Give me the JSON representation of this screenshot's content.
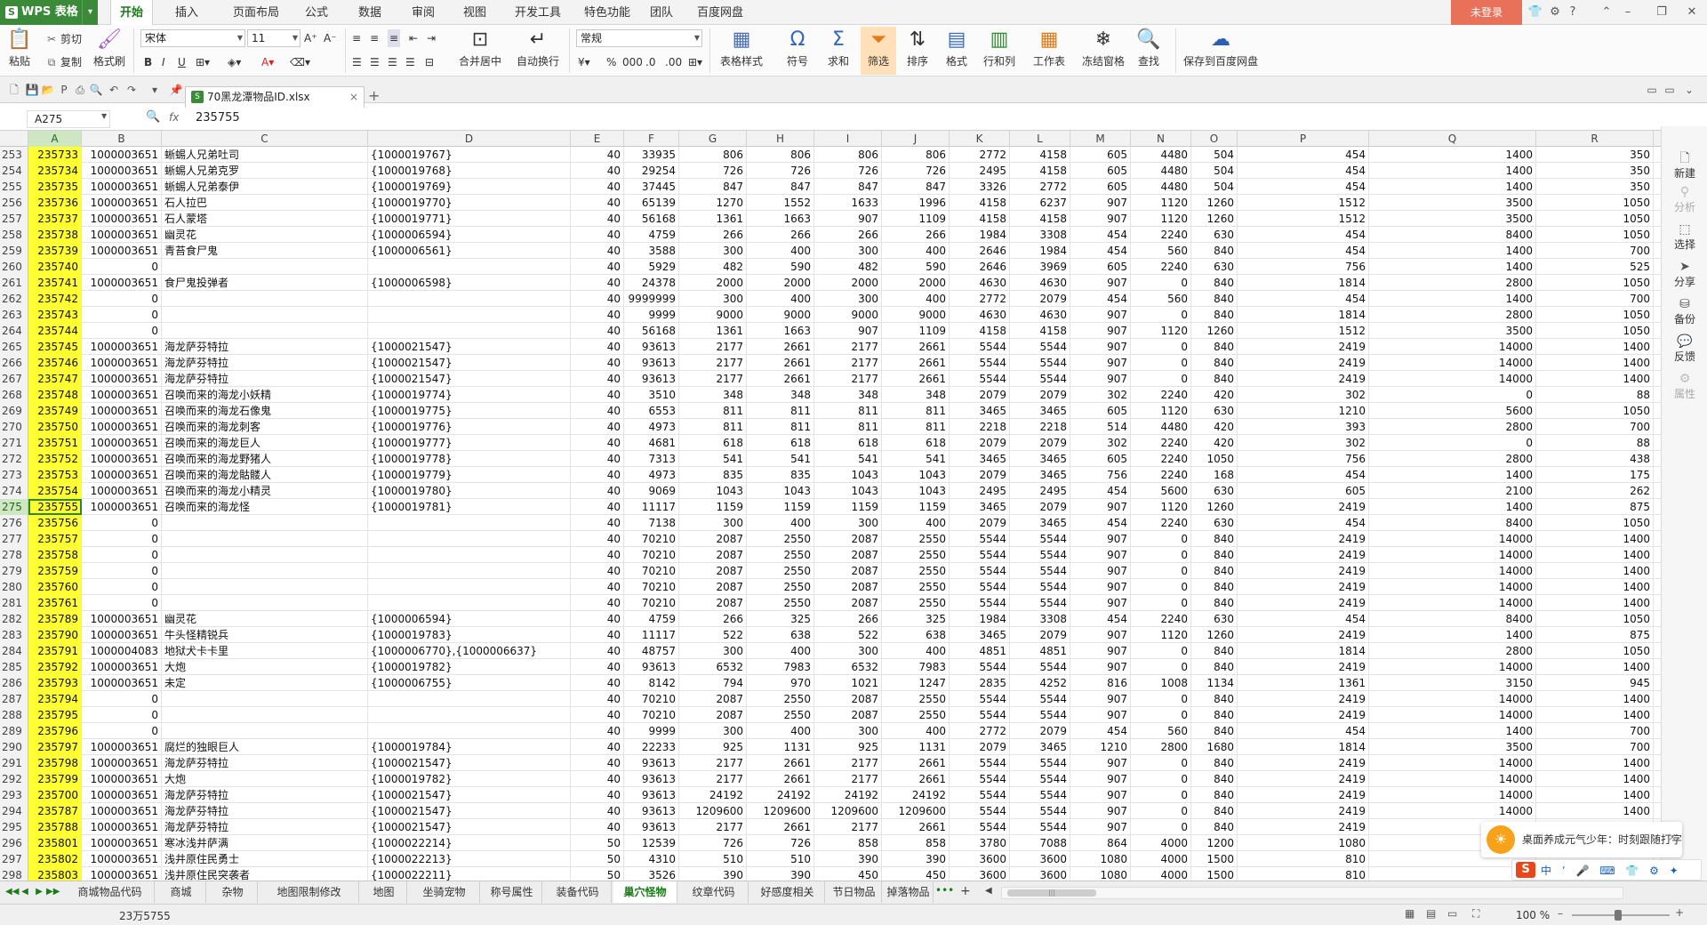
{
  "app": {
    "name": "WPS 表格",
    "dropdown": "▾",
    "login": "未登录"
  },
  "menu": [
    "开始",
    "插入",
    "页面布局",
    "公式",
    "数据",
    "审阅",
    "视图",
    "开发工具",
    "特色功能",
    "团队",
    "百度网盘"
  ],
  "ribbon": {
    "paste": "粘贴",
    "cut": "剪切",
    "copy": "复制",
    "format_painter": "格式刷",
    "font": "宋体",
    "size": "11",
    "bold": "B",
    "italic": "I",
    "underline": "U",
    "merge": "合并居中",
    "wrap": "自动换行",
    "numfmt": "常规",
    "percent": "%",
    "table_style": "表格样式",
    "symbol": "符号",
    "sum": "求和",
    "filter": "筛选",
    "sort": "排序",
    "format": "格式",
    "rowcol": "行和列",
    "sheet": "工作表",
    "freeze": "冻结窗格",
    "find": "查找",
    "save_baidu": "保存到百度网盘"
  },
  "doc": {
    "tab": "70黑龙潭物品ID.xlsx",
    "close": "×",
    "add": "+"
  },
  "formula": {
    "cell": "A275",
    "fx": "fx",
    "value": "235755"
  },
  "columns": [
    "A",
    "B",
    "C",
    "D",
    "E",
    "F",
    "G",
    "H",
    "I",
    "J",
    "K",
    "L",
    "M",
    "N",
    "O",
    "P",
    "Q",
    "R"
  ],
  "rows": [
    {
      "n": "253",
      "a": "235733",
      "b": "1000003651",
      "c": "蜥蜴人兄弟吐司",
      "d": "{1000019767}",
      "e": "40",
      "f": "33935",
      "g": "806",
      "h": "806",
      "i": "806",
      "j": "806",
      "k": "2772",
      "l": "4158",
      "m": "605",
      "nn": "4480",
      "o": "504",
      "p": "454",
      "q": "1400",
      "r": "350"
    },
    {
      "n": "254",
      "a": "235734",
      "b": "1000003651",
      "c": "蜥蜴人兄弟克罗",
      "d": "{1000019768}",
      "e": "40",
      "f": "29254",
      "g": "726",
      "h": "726",
      "i": "726",
      "j": "726",
      "k": "2495",
      "l": "4158",
      "m": "605",
      "nn": "4480",
      "o": "504",
      "p": "454",
      "q": "1400",
      "r": "350"
    },
    {
      "n": "255",
      "a": "235735",
      "b": "1000003651",
      "c": "蜥蜴人兄弟泰伊",
      "d": "{1000019769}",
      "e": "40",
      "f": "37445",
      "g": "847",
      "h": "847",
      "i": "847",
      "j": "847",
      "k": "3326",
      "l": "2772",
      "m": "605",
      "nn": "4480",
      "o": "504",
      "p": "454",
      "q": "1400",
      "r": "350"
    },
    {
      "n": "256",
      "a": "235736",
      "b": "1000003651",
      "c": "石人拉巴",
      "d": "{1000019770}",
      "e": "40",
      "f": "65139",
      "g": "1270",
      "h": "1552",
      "i": "1633",
      "j": "1996",
      "k": "4158",
      "l": "6237",
      "m": "907",
      "nn": "1120",
      "o": "1260",
      "p": "1512",
      "q": "3500",
      "r": "1050"
    },
    {
      "n": "257",
      "a": "235737",
      "b": "1000003651",
      "c": "石人蒙塔",
      "d": "{1000019771}",
      "e": "40",
      "f": "56168",
      "g": "1361",
      "h": "1663",
      "i": "907",
      "j": "1109",
      "k": "4158",
      "l": "4158",
      "m": "907",
      "nn": "1120",
      "o": "1260",
      "p": "1512",
      "q": "3500",
      "r": "1050"
    },
    {
      "n": "258",
      "a": "235738",
      "b": "1000003651",
      "c": "幽灵花",
      "d": "{1000006594}",
      "e": "40",
      "f": "4759",
      "g": "266",
      "h": "266",
      "i": "266",
      "j": "266",
      "k": "1984",
      "l": "3308",
      "m": "454",
      "nn": "2240",
      "o": "630",
      "p": "454",
      "q": "8400",
      "r": "1050"
    },
    {
      "n": "259",
      "a": "235739",
      "b": "1000003651",
      "c": "青苔食尸鬼",
      "d": "{1000006561}",
      "e": "40",
      "f": "3588",
      "g": "300",
      "h": "400",
      "i": "300",
      "j": "400",
      "k": "2646",
      "l": "1984",
      "m": "454",
      "nn": "560",
      "o": "840",
      "p": "454",
      "q": "1400",
      "r": "700"
    },
    {
      "n": "260",
      "a": "235740",
      "b": "0",
      "c": "",
      "d": "",
      "e": "40",
      "f": "5929",
      "g": "482",
      "h": "590",
      "i": "482",
      "j": "590",
      "k": "2646",
      "l": "3969",
      "m": "605",
      "nn": "2240",
      "o": "630",
      "p": "756",
      "q": "1400",
      "r": "525"
    },
    {
      "n": "261",
      "a": "235741",
      "b": "1000003651",
      "c": "食尸鬼投弹者",
      "d": "{1000006598}",
      "e": "40",
      "f": "24378",
      "g": "2000",
      "h": "2000",
      "i": "2000",
      "j": "2000",
      "k": "4630",
      "l": "4630",
      "m": "907",
      "nn": "0",
      "o": "840",
      "p": "1814",
      "q": "2800",
      "r": "1050"
    },
    {
      "n": "262",
      "a": "235742",
      "b": "0",
      "c": "",
      "d": "",
      "e": "40",
      "f": "9999999",
      "g": "300",
      "h": "400",
      "i": "300",
      "j": "400",
      "k": "2772",
      "l": "2079",
      "m": "454",
      "nn": "560",
      "o": "840",
      "p": "454",
      "q": "1400",
      "r": "700"
    },
    {
      "n": "263",
      "a": "235743",
      "b": "0",
      "c": "",
      "d": "",
      "e": "40",
      "f": "9999",
      "g": "9000",
      "h": "9000",
      "i": "9000",
      "j": "9000",
      "k": "4630",
      "l": "4630",
      "m": "907",
      "nn": "0",
      "o": "840",
      "p": "1814",
      "q": "2800",
      "r": "1050"
    },
    {
      "n": "264",
      "a": "235744",
      "b": "0",
      "c": "",
      "d": "",
      "e": "40",
      "f": "56168",
      "g": "1361",
      "h": "1663",
      "i": "907",
      "j": "1109",
      "k": "4158",
      "l": "4158",
      "m": "907",
      "nn": "1120",
      "o": "1260",
      "p": "1512",
      "q": "3500",
      "r": "1050"
    },
    {
      "n": "265",
      "a": "235745",
      "b": "1000003651",
      "c": "海龙萨芬特拉",
      "d": "{1000021547}",
      "e": "40",
      "f": "93613",
      "g": "2177",
      "h": "2661",
      "i": "2177",
      "j": "2661",
      "k": "5544",
      "l": "5544",
      "m": "907",
      "nn": "0",
      "o": "840",
      "p": "2419",
      "q": "14000",
      "r": "1400"
    },
    {
      "n": "266",
      "a": "235746",
      "b": "1000003651",
      "c": "海龙萨芬特拉",
      "d": "{1000021547}",
      "e": "40",
      "f": "93613",
      "g": "2177",
      "h": "2661",
      "i": "2177",
      "j": "2661",
      "k": "5544",
      "l": "5544",
      "m": "907",
      "nn": "0",
      "o": "840",
      "p": "2419",
      "q": "14000",
      "r": "1400"
    },
    {
      "n": "267",
      "a": "235747",
      "b": "1000003651",
      "c": "海龙萨芬特拉",
      "d": "{1000021547}",
      "e": "40",
      "f": "93613",
      "g": "2177",
      "h": "2661",
      "i": "2177",
      "j": "2661",
      "k": "5544",
      "l": "5544",
      "m": "907",
      "nn": "0",
      "o": "840",
      "p": "2419",
      "q": "14000",
      "r": "1400"
    },
    {
      "n": "268",
      "a": "235748",
      "b": "1000003651",
      "c": "召唤而来的海龙小妖精",
      "d": "{1000019774}",
      "e": "40",
      "f": "3510",
      "g": "348",
      "h": "348",
      "i": "348",
      "j": "348",
      "k": "2079",
      "l": "2079",
      "m": "302",
      "nn": "2240",
      "o": "420",
      "p": "302",
      "q": "0",
      "r": "88"
    },
    {
      "n": "269",
      "a": "235749",
      "b": "1000003651",
      "c": "召唤而来的海龙石像鬼",
      "d": "{1000019775}",
      "e": "40",
      "f": "6553",
      "g": "811",
      "h": "811",
      "i": "811",
      "j": "811",
      "k": "3465",
      "l": "3465",
      "m": "605",
      "nn": "1120",
      "o": "630",
      "p": "1210",
      "q": "5600",
      "r": "1050"
    },
    {
      "n": "270",
      "a": "235750",
      "b": "1000003651",
      "c": "召唤而来的海龙刺客",
      "d": "{1000019776}",
      "e": "40",
      "f": "4973",
      "g": "811",
      "h": "811",
      "i": "811",
      "j": "811",
      "k": "2218",
      "l": "2218",
      "m": "514",
      "nn": "4480",
      "o": "420",
      "p": "393",
      "q": "2800",
      "r": "700"
    },
    {
      "n": "271",
      "a": "235751",
      "b": "1000003651",
      "c": "召唤而来的海龙巨人",
      "d": "{1000019777}",
      "e": "40",
      "f": "4681",
      "g": "618",
      "h": "618",
      "i": "618",
      "j": "618",
      "k": "2079",
      "l": "2079",
      "m": "302",
      "nn": "2240",
      "o": "420",
      "p": "302",
      "q": "0",
      "r": "88"
    },
    {
      "n": "272",
      "a": "235752",
      "b": "1000003651",
      "c": "召唤而来的海龙野猪人",
      "d": "{1000019778}",
      "e": "40",
      "f": "7313",
      "g": "541",
      "h": "541",
      "i": "541",
      "j": "541",
      "k": "3465",
      "l": "3465",
      "m": "605",
      "nn": "2240",
      "o": "1050",
      "p": "756",
      "q": "2800",
      "r": "438"
    },
    {
      "n": "273",
      "a": "235753",
      "b": "1000003651",
      "c": "召唤而来的海龙骷髅人",
      "d": "{1000019779}",
      "e": "40",
      "f": "4973",
      "g": "835",
      "h": "835",
      "i": "1043",
      "j": "1043",
      "k": "2079",
      "l": "3465",
      "m": "756",
      "nn": "2240",
      "o": "168",
      "p": "454",
      "q": "1400",
      "r": "175"
    },
    {
      "n": "274",
      "a": "235754",
      "b": "1000003651",
      "c": "召唤而来的海龙小精灵",
      "d": "{1000019780}",
      "e": "40",
      "f": "9069",
      "g": "1043",
      "h": "1043",
      "i": "1043",
      "j": "1043",
      "k": "2495",
      "l": "2495",
      "m": "454",
      "nn": "5600",
      "o": "630",
      "p": "605",
      "q": "2100",
      "r": "262"
    },
    {
      "n": "275",
      "a": "235755",
      "b": "1000003651",
      "c": "召唤而来的海龙怪",
      "d": "{1000019781}",
      "e": "40",
      "f": "11117",
      "g": "1159",
      "h": "1159",
      "i": "1159",
      "j": "1159",
      "k": "3465",
      "l": "2079",
      "m": "907",
      "nn": "1120",
      "o": "1260",
      "p": "2419",
      "q": "1400",
      "r": "875",
      "active": true
    },
    {
      "n": "276",
      "a": "235756",
      "b": "0",
      "c": "",
      "d": "",
      "e": "40",
      "f": "7138",
      "g": "300",
      "h": "400",
      "i": "300",
      "j": "400",
      "k": "2079",
      "l": "3465",
      "m": "454",
      "nn": "2240",
      "o": "630",
      "p": "454",
      "q": "8400",
      "r": "1050"
    },
    {
      "n": "277",
      "a": "235757",
      "b": "0",
      "c": "",
      "d": "",
      "e": "40",
      "f": "70210",
      "g": "2087",
      "h": "2550",
      "i": "2087",
      "j": "2550",
      "k": "5544",
      "l": "5544",
      "m": "907",
      "nn": "0",
      "o": "840",
      "p": "2419",
      "q": "14000",
      "r": "1400"
    },
    {
      "n": "278",
      "a": "235758",
      "b": "0",
      "c": "",
      "d": "",
      "e": "40",
      "f": "70210",
      "g": "2087",
      "h": "2550",
      "i": "2087",
      "j": "2550",
      "k": "5544",
      "l": "5544",
      "m": "907",
      "nn": "0",
      "o": "840",
      "p": "2419",
      "q": "14000",
      "r": "1400"
    },
    {
      "n": "279",
      "a": "235759",
      "b": "0",
      "c": "",
      "d": "",
      "e": "40",
      "f": "70210",
      "g": "2087",
      "h": "2550",
      "i": "2087",
      "j": "2550",
      "k": "5544",
      "l": "5544",
      "m": "907",
      "nn": "0",
      "o": "840",
      "p": "2419",
      "q": "14000",
      "r": "1400"
    },
    {
      "n": "280",
      "a": "235760",
      "b": "0",
      "c": "",
      "d": "",
      "e": "40",
      "f": "70210",
      "g": "2087",
      "h": "2550",
      "i": "2087",
      "j": "2550",
      "k": "5544",
      "l": "5544",
      "m": "907",
      "nn": "0",
      "o": "840",
      "p": "2419",
      "q": "14000",
      "r": "1400"
    },
    {
      "n": "281",
      "a": "235761",
      "b": "0",
      "c": "",
      "d": "",
      "e": "40",
      "f": "70210",
      "g": "2087",
      "h": "2550",
      "i": "2087",
      "j": "2550",
      "k": "5544",
      "l": "5544",
      "m": "907",
      "nn": "0",
      "o": "840",
      "p": "2419",
      "q": "14000",
      "r": "1400"
    },
    {
      "n": "282",
      "a": "235789",
      "b": "1000003651",
      "c": "幽灵花",
      "d": "{1000006594}",
      "e": "40",
      "f": "4759",
      "g": "266",
      "h": "325",
      "i": "266",
      "j": "325",
      "k": "1984",
      "l": "3308",
      "m": "454",
      "nn": "2240",
      "o": "630",
      "p": "454",
      "q": "8400",
      "r": "1050"
    },
    {
      "n": "283",
      "a": "235790",
      "b": "1000003651",
      "c": "牛头怪精锐兵",
      "d": "{1000019783}",
      "e": "40",
      "f": "11117",
      "g": "522",
      "h": "638",
      "i": "522",
      "j": "638",
      "k": "3465",
      "l": "2079",
      "m": "907",
      "nn": "1120",
      "o": "1260",
      "p": "2419",
      "q": "1400",
      "r": "875"
    },
    {
      "n": "284",
      "a": "235791",
      "b": "1000004083",
      "c": "地狱犬卡卡里",
      "d": "{1000006770},{1000006637}",
      "e": "40",
      "f": "48757",
      "g": "300",
      "h": "400",
      "i": "300",
      "j": "400",
      "k": "4851",
      "l": "4851",
      "m": "907",
      "nn": "0",
      "o": "840",
      "p": "1814",
      "q": "2800",
      "r": "1050"
    },
    {
      "n": "285",
      "a": "235792",
      "b": "1000003651",
      "c": "大炮",
      "d": "{1000019782}",
      "e": "40",
      "f": "93613",
      "g": "6532",
      "h": "7983",
      "i": "6532",
      "j": "7983",
      "k": "5544",
      "l": "5544",
      "m": "907",
      "nn": "0",
      "o": "840",
      "p": "2419",
      "q": "14000",
      "r": "1400"
    },
    {
      "n": "286",
      "a": "235793",
      "b": "1000003651",
      "c": "未定",
      "d": "{1000006755}",
      "e": "40",
      "f": "8142",
      "g": "794",
      "h": "970",
      "i": "1021",
      "j": "1247",
      "k": "2835",
      "l": "4252",
      "m": "816",
      "nn": "1008",
      "o": "1134",
      "p": "1361",
      "q": "3150",
      "r": "945"
    },
    {
      "n": "287",
      "a": "235794",
      "b": "0",
      "c": "",
      "d": "",
      "e": "40",
      "f": "70210",
      "g": "2087",
      "h": "2550",
      "i": "2087",
      "j": "2550",
      "k": "5544",
      "l": "5544",
      "m": "907",
      "nn": "0",
      "o": "840",
      "p": "2419",
      "q": "14000",
      "r": "1400"
    },
    {
      "n": "288",
      "a": "235795",
      "b": "0",
      "c": "",
      "d": "",
      "e": "40",
      "f": "70210",
      "g": "2087",
      "h": "2550",
      "i": "2087",
      "j": "2550",
      "k": "5544",
      "l": "5544",
      "m": "907",
      "nn": "0",
      "o": "840",
      "p": "2419",
      "q": "14000",
      "r": "1400"
    },
    {
      "n": "289",
      "a": "235796",
      "b": "0",
      "c": "",
      "d": "",
      "e": "40",
      "f": "9999",
      "g": "300",
      "h": "400",
      "i": "300",
      "j": "400",
      "k": "2772",
      "l": "2079",
      "m": "454",
      "nn": "560",
      "o": "840",
      "p": "454",
      "q": "1400",
      "r": "700"
    },
    {
      "n": "290",
      "a": "235797",
      "b": "1000003651",
      "c": "腐烂的独眼巨人",
      "d": "{1000019784}",
      "e": "40",
      "f": "22233",
      "g": "925",
      "h": "1131",
      "i": "925",
      "j": "1131",
      "k": "2079",
      "l": "3465",
      "m": "1210",
      "nn": "2800",
      "o": "1680",
      "p": "1814",
      "q": "3500",
      "r": "700"
    },
    {
      "n": "291",
      "a": "235798",
      "b": "1000003651",
      "c": "海龙萨芬特拉",
      "d": "{1000021547}",
      "e": "40",
      "f": "93613",
      "g": "2177",
      "h": "2661",
      "i": "2177",
      "j": "2661",
      "k": "5544",
      "l": "5544",
      "m": "907",
      "nn": "0",
      "o": "840",
      "p": "2419",
      "q": "14000",
      "r": "1400"
    },
    {
      "n": "292",
      "a": "235799",
      "b": "1000003651",
      "c": "大炮",
      "d": "{1000019782}",
      "e": "40",
      "f": "93613",
      "g": "2177",
      "h": "2661",
      "i": "2177",
      "j": "2661",
      "k": "5544",
      "l": "5544",
      "m": "907",
      "nn": "0",
      "o": "840",
      "p": "2419",
      "q": "14000",
      "r": "1400"
    },
    {
      "n": "293",
      "a": "235700",
      "b": "1000003651",
      "c": "海龙萨芬特拉",
      "d": "{1000021547}",
      "e": "40",
      "f": "93613",
      "g": "24192",
      "h": "24192",
      "i": "24192",
      "j": "24192",
      "k": "5544",
      "l": "5544",
      "m": "907",
      "nn": "0",
      "o": "840",
      "p": "2419",
      "q": "14000",
      "r": "1400"
    },
    {
      "n": "294",
      "a": "235787",
      "b": "1000003651",
      "c": "海龙萨芬特拉",
      "d": "{1000021547}",
      "e": "40",
      "f": "93613",
      "g": "1209600",
      "h": "1209600",
      "i": "1209600",
      "j": "1209600",
      "k": "5544",
      "l": "5544",
      "m": "907",
      "nn": "0",
      "o": "840",
      "p": "2419",
      "q": "14000",
      "r": "1400"
    },
    {
      "n": "295",
      "a": "235788",
      "b": "1000003651",
      "c": "海龙萨芬特拉",
      "d": "{1000021547}",
      "e": "40",
      "f": "93613",
      "g": "2177",
      "h": "2661",
      "i": "2177",
      "j": "2661",
      "k": "5544",
      "l": "5544",
      "m": "907",
      "nn": "0",
      "o": "840",
      "p": "2419",
      "q": "14000",
      "r": "1400"
    },
    {
      "n": "296",
      "a": "235801",
      "b": "1000003651",
      "c": "寒冰浅井萨满",
      "d": "{1000022214}",
      "e": "50",
      "f": "12539",
      "g": "726",
      "h": "726",
      "i": "858",
      "j": "858",
      "k": "3780",
      "l": "7088",
      "m": "864",
      "nn": "4000",
      "o": "1200",
      "p": "1080",
      "q": "",
      "r": ""
    },
    {
      "n": "297",
      "a": "235802",
      "b": "1000003651",
      "c": "浅井原住民勇士",
      "d": "{1000022213}",
      "e": "50",
      "f": "4310",
      "g": "510",
      "h": "510",
      "i": "390",
      "j": "390",
      "k": "3600",
      "l": "3600",
      "m": "1080",
      "nn": "4000",
      "o": "1500",
      "p": "810",
      "q": "",
      "r": ""
    },
    {
      "n": "298",
      "a": "235803",
      "b": "1000003651",
      "c": "浅井原住民突袭者",
      "d": "{1000022211}",
      "e": "50",
      "f": "3526",
      "g": "390",
      "h": "390",
      "i": "450",
      "j": "450",
      "k": "3600",
      "l": "3600",
      "m": "1080",
      "nn": "4000",
      "o": "1500",
      "p": "810",
      "q": "",
      "r": ""
    }
  ],
  "side": [
    "新建",
    "分析",
    "选择",
    "分享",
    "备份",
    "反馈",
    "属性"
  ],
  "sheets": [
    "商城物品代码",
    "商城",
    "杂物",
    "地图限制修改",
    "地图",
    "坐骑宠物",
    "称号属性",
    "装备代码",
    "巢穴怪物",
    "纹章代码",
    "好感度相关",
    "节日物品",
    "掉落物品"
  ],
  "active_sheet": "巢穴怪物",
  "more_sheets": "•••",
  "status": {
    "value": "23万5755",
    "zoom": "100 %"
  },
  "notify": {
    "text": "桌面养成元气少年：时刻跟随打字",
    "close": "×"
  },
  "ime": {
    "logo": "S",
    "text": "中 ʼ 🎤 ⌨ 👕 ⚙ ✦"
  }
}
